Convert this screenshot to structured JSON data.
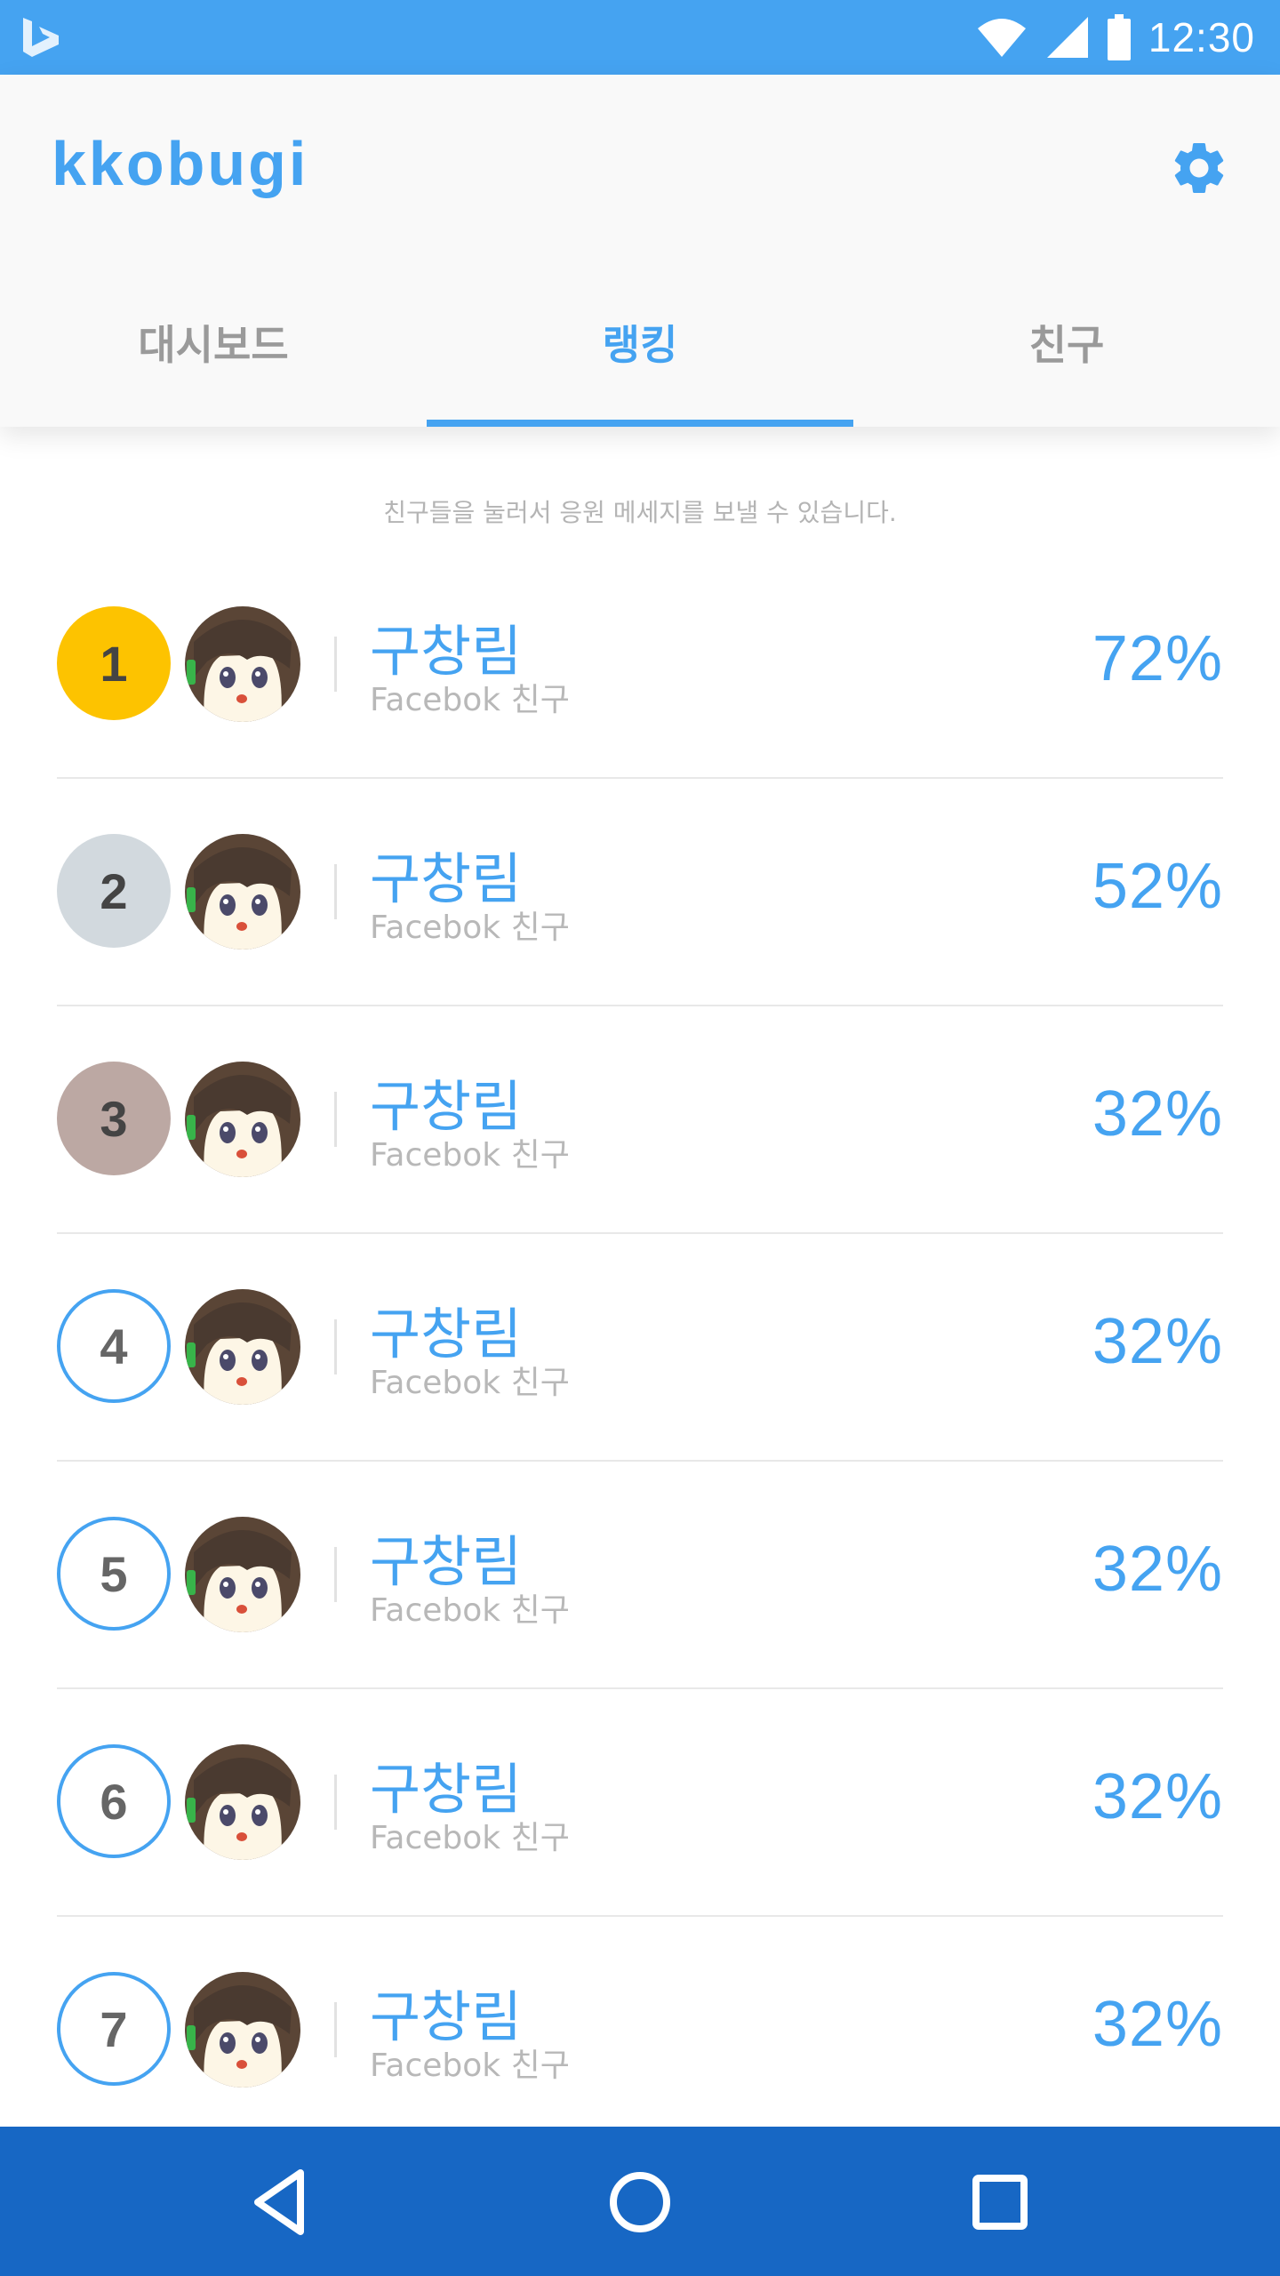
{
  "status_bar": {
    "time": "12:30"
  },
  "app": {
    "title": "kkobugi",
    "settings_icon": "gear-icon",
    "accent": "#45a3f1"
  },
  "tabs": [
    {
      "label": "대시보드",
      "active": false
    },
    {
      "label": "랭킹",
      "active": true
    },
    {
      "label": "친구",
      "active": false
    }
  ],
  "hint": "친구들을 눌러서 응원 메세지를 보낼 수 있습니다.",
  "ranking": [
    {
      "rank": "1",
      "name": "구창림",
      "source": "Facebok 친구",
      "percent": "72%"
    },
    {
      "rank": "2",
      "name": "구창림",
      "source": "Facebok 친구",
      "percent": "52%"
    },
    {
      "rank": "3",
      "name": "구창림",
      "source": "Facebok 친구",
      "percent": "32%"
    },
    {
      "rank": "4",
      "name": "구창림",
      "source": "Facebok 친구",
      "percent": "32%"
    },
    {
      "rank": "5",
      "name": "구창림",
      "source": "Facebok 친구",
      "percent": "32%"
    },
    {
      "rank": "6",
      "name": "구창림",
      "source": "Facebok 친구",
      "percent": "32%"
    },
    {
      "rank": "7",
      "name": "구창림",
      "source": "Facebok 친구",
      "percent": "32%"
    }
  ],
  "colors": {
    "gold": "#fdc300",
    "silver": "#d2d9de",
    "bronze": "#bca8a3",
    "nav_bar": "#1767c4",
    "status_bar": "#45a3f1"
  }
}
